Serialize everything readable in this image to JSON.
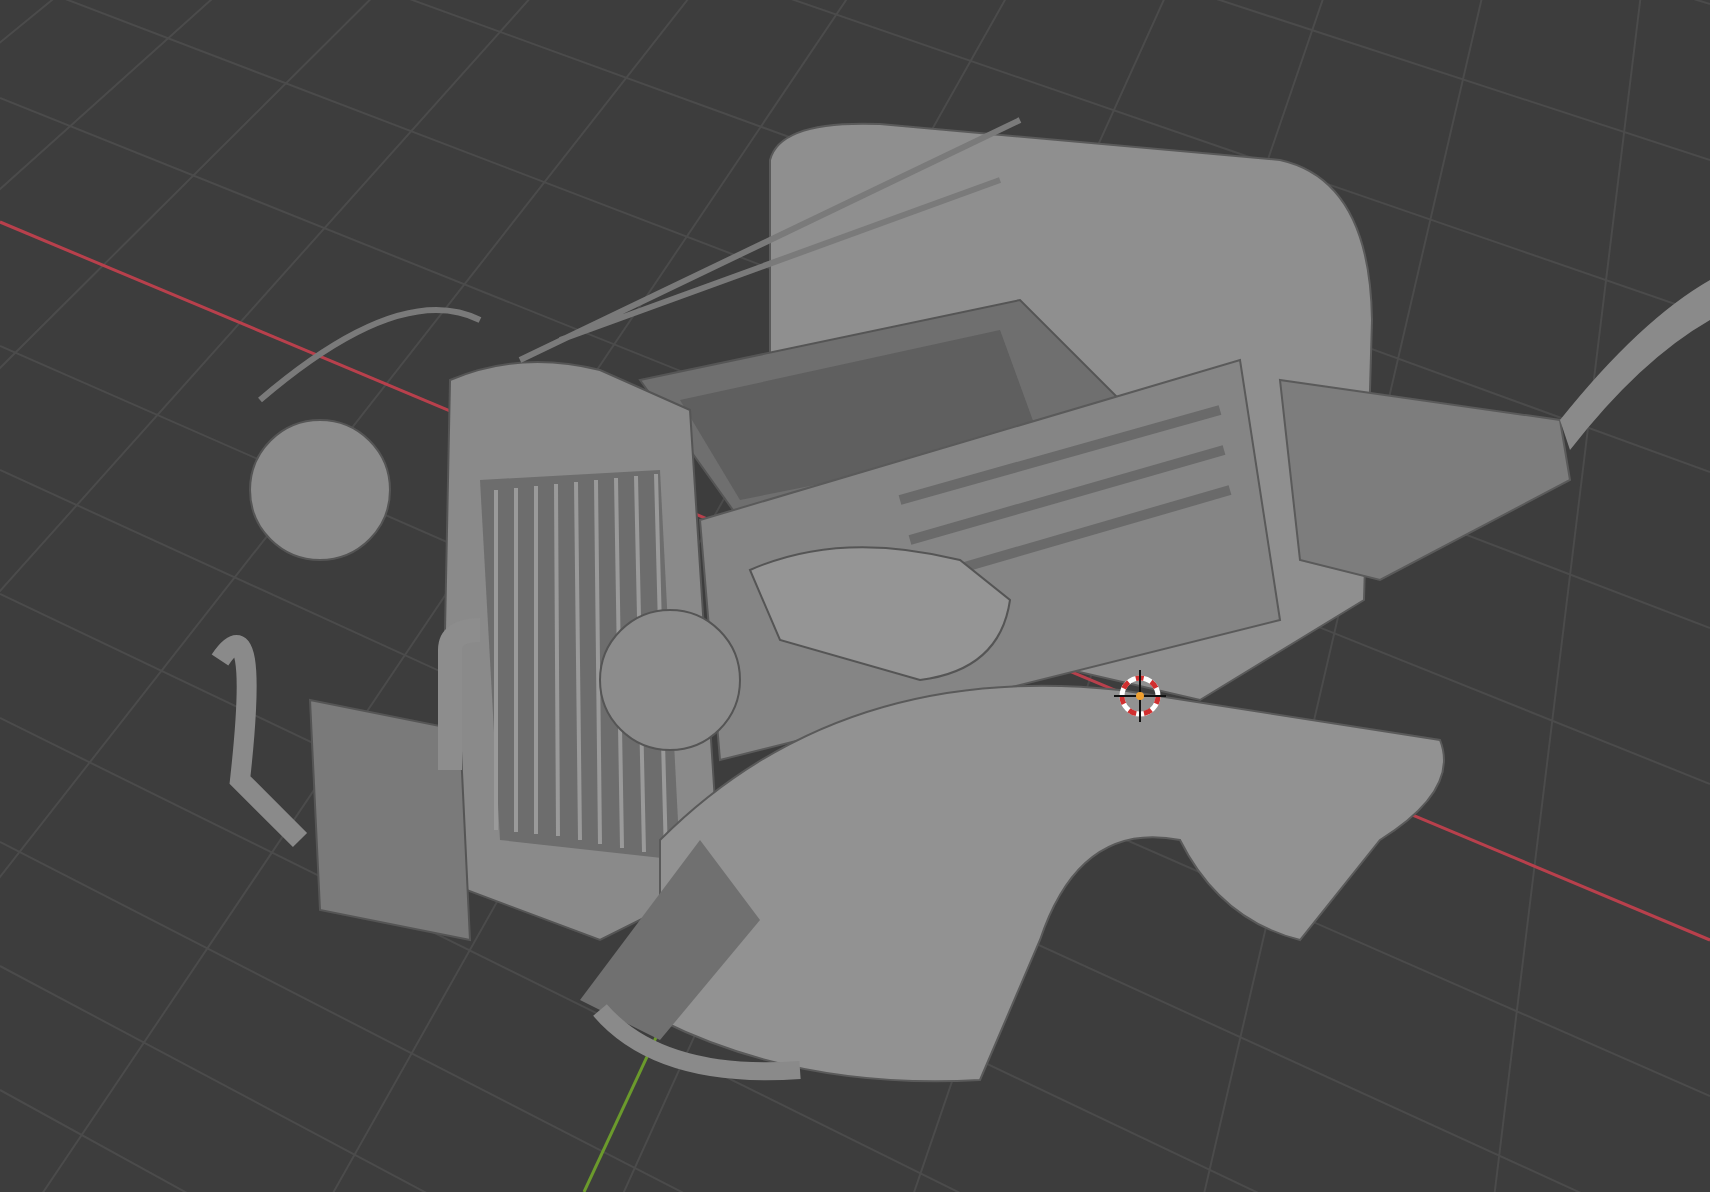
{
  "viewport": {
    "show_grid": true,
    "show_3d_cursor": true,
    "axes": [
      {
        "kind": "x",
        "color": "#b8404c"
      },
      {
        "kind": "y",
        "color": "#6b9a2c"
      }
    ]
  }
}
